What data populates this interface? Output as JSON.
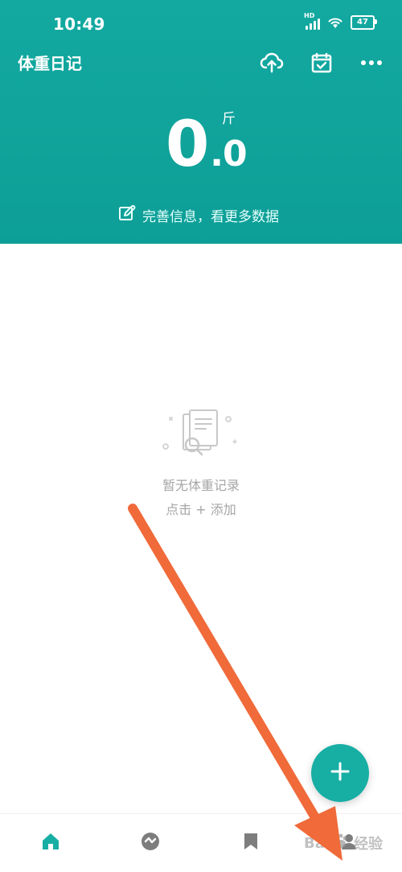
{
  "status_bar": {
    "time": "10:49",
    "network_badge": "HD",
    "battery": "47"
  },
  "header": {
    "title": "体重日记",
    "actions": {
      "cloud_upload_icon": "cloud-upload-icon",
      "calendar_check_icon": "calendar-check-icon",
      "more_icon": "more-icon"
    },
    "weight_integer": "0",
    "weight_decimal": ".0",
    "unit": "斤",
    "info_link": "完善信息，看更多数据"
  },
  "empty_state": {
    "title": "暂无体重记录",
    "hint": "点击 + 添加"
  },
  "fab": {
    "icon": "plus-icon"
  },
  "bottom_nav": {
    "items": [
      {
        "icon": "home-icon",
        "active": true
      },
      {
        "icon": "trend-icon",
        "active": false
      },
      {
        "icon": "bookmark-icon",
        "active": false
      },
      {
        "icon": "profile-icon",
        "active": false
      }
    ]
  },
  "watermark": {
    "text": "Bai",
    "suffix": "经验"
  },
  "colors": {
    "brand": "#13a9a0",
    "arrow": "#f06a3a"
  }
}
